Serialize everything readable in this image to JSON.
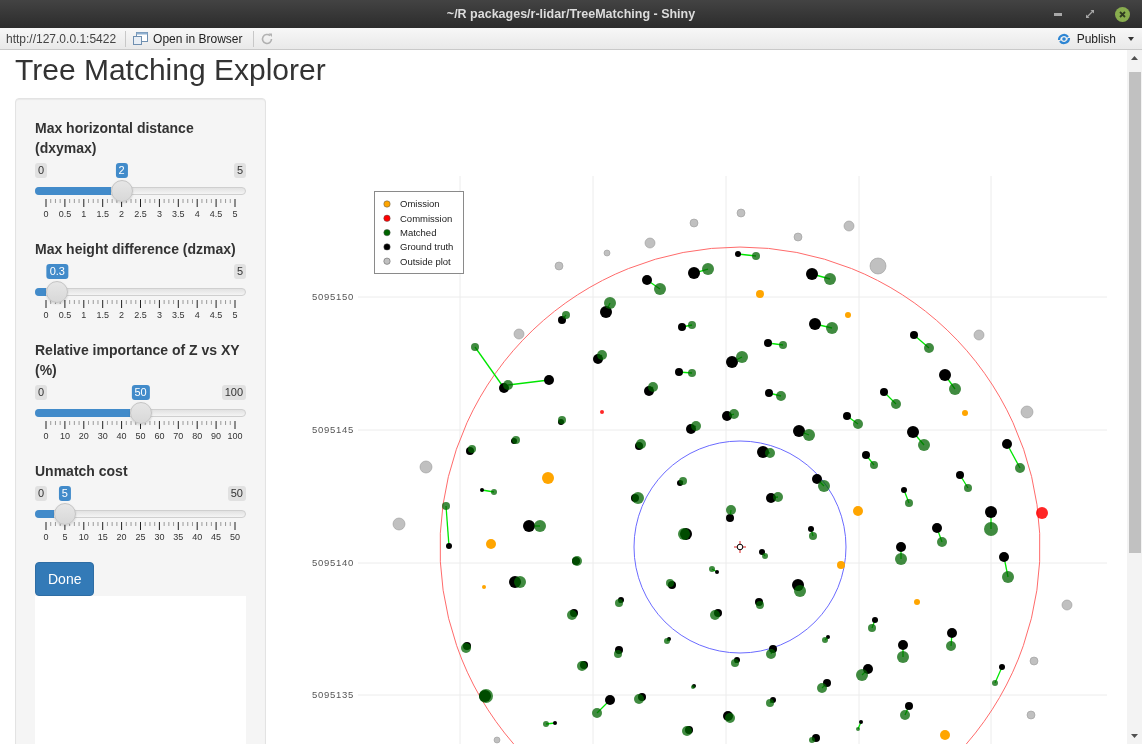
{
  "window": {
    "title": "~/R packages/r-lidar/TreeMatching - Shiny"
  },
  "toolbar": {
    "url": "http://127.0.0.1:5422",
    "open_button": "Open in Browser",
    "refresh_button": {
      "disabled": true
    },
    "publish_button": "Publish"
  },
  "page": {
    "title": "Tree Matching Explorer"
  },
  "sidebar": {
    "sliders": [
      {
        "label": "Max horizontal distance (dxymax)",
        "min": "0",
        "max": "5",
        "value": "2",
        "level": 0.4,
        "ticks": [
          "0",
          "0.5",
          "1",
          "1.5",
          "2",
          "2.5",
          "3",
          "3.5",
          "4",
          "4.5",
          "5"
        ]
      },
      {
        "label": "Max height difference (dzmax)",
        "max": "5",
        "value": "0.3",
        "level": 0.06,
        "ticks": [
          "0",
          "0.5",
          "1",
          "1.5",
          "2",
          "2.5",
          "3",
          "3.5",
          "4",
          "4.5",
          "5"
        ]
      },
      {
        "label": "Relative importance of Z vs XY (%)",
        "min": "0",
        "max": "100",
        "value": "50",
        "level": 0.5,
        "ticks": [
          "0",
          "10",
          "20",
          "30",
          "40",
          "50",
          "60",
          "70",
          "80",
          "90",
          "100"
        ]
      },
      {
        "label": "Unmatch cost",
        "min": "0",
        "max": "50",
        "value": "5",
        "level": 0.1,
        "ticks": [
          "0",
          "5",
          "10",
          "15",
          "20",
          "25",
          "30",
          "35",
          "40",
          "45",
          "50"
        ]
      }
    ],
    "done_button": "Done"
  },
  "plot": {
    "legend": [
      {
        "label": "Omission",
        "color": "#ffa500"
      },
      {
        "label": "Commission",
        "color": "#ff0000"
      },
      {
        "label": "Matched",
        "color": "#006400"
      },
      {
        "label": "Ground truth",
        "color": "#000000"
      },
      {
        "label": "Outside plot",
        "color": "#c0c0c0"
      }
    ],
    "y_tick_labels": [
      "5095150",
      "5095145",
      "5095140",
      "5095135"
    ]
  }
}
